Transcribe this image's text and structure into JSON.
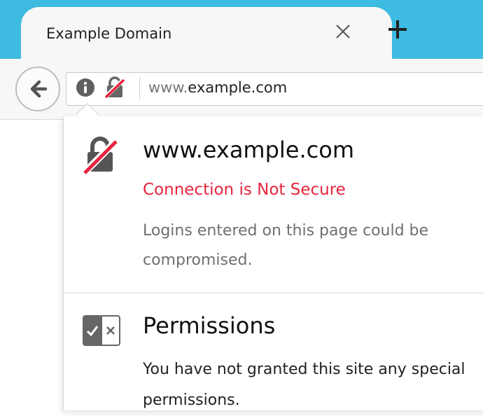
{
  "tab": {
    "title": "Example Domain",
    "close_icon": "close-icon",
    "new_tab_icon": "plus-icon"
  },
  "navbar": {
    "back_icon": "arrow-left-icon",
    "info_icon": "info-icon",
    "security_icon": "insecure-lock-icon",
    "url_prefix": "www.",
    "url_domain": "example.com"
  },
  "site_info_panel": {
    "host": "www.example.com",
    "connection_status": "Connection is Not Secure",
    "connection_description": "Logins entered on this page could be compromised.",
    "permissions_title": "Permissions",
    "permissions_description": "You have not granted this site any special permissions."
  },
  "colors": {
    "titlebar": "#3dbbe0",
    "insecure_red": "#e5253d",
    "toolbar_bg": "#f7f7f7"
  }
}
